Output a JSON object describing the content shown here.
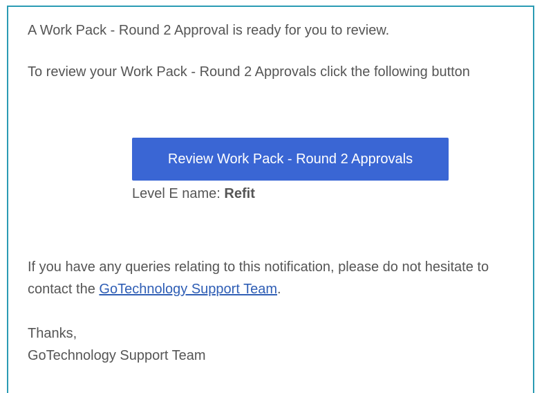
{
  "email": {
    "intro": "A Work Pack - Round 2 Approval is ready for you to review.",
    "instruction": "To review your Work Pack - Round 2 Approvals click the following button",
    "button_label": "Review Work Pack - Round 2 Approvals",
    "level_label": "Level E name: ",
    "level_value": "Refit",
    "queries_before": "If you have any queries relating to this notification, please do not hesitate to contact the ",
    "support_link": "GoTechnology Support Team",
    "queries_after": ".",
    "thanks": "Thanks,",
    "signature": "GoTechnology Support Team"
  },
  "colors": {
    "frame_border": "#2a9bb3",
    "button_bg": "#3a66d4",
    "link": "#2f5eb5",
    "text": "#555555"
  }
}
